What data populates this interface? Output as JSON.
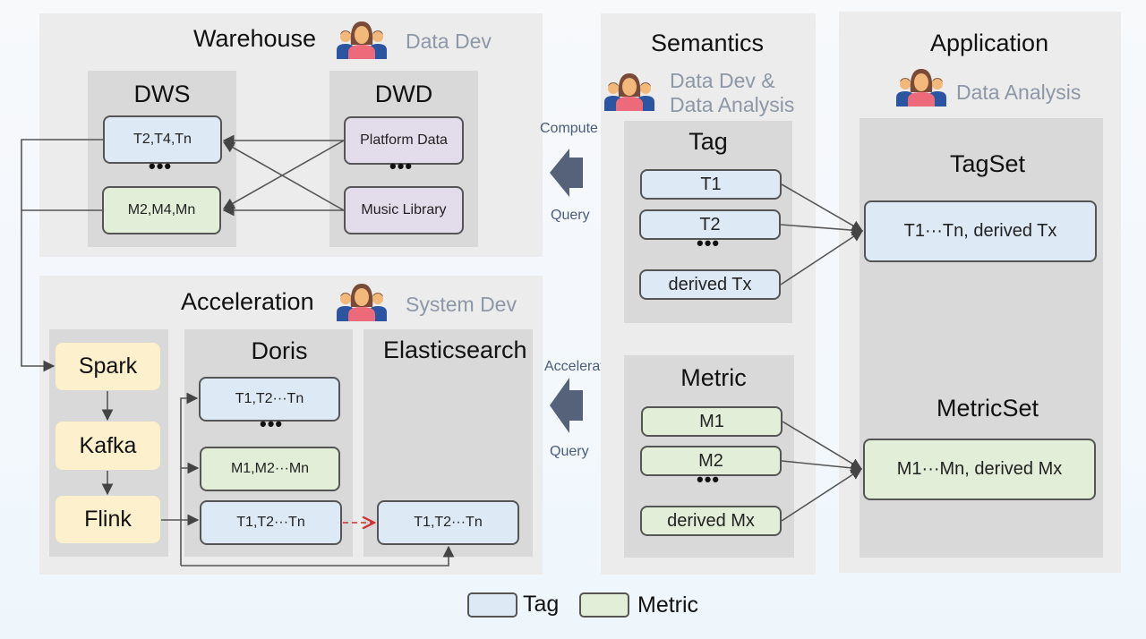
{
  "warehouse": {
    "title": "Warehouse",
    "role": "Data Dev",
    "dws": {
      "title": "DWS",
      "items": [
        {
          "label": "T2,T4,Tn",
          "kind": "tag"
        },
        {
          "label": "M2,M4,Mn",
          "kind": "metric"
        }
      ]
    },
    "dwd": {
      "title": "DWD",
      "items": [
        {
          "label": "Platform Data",
          "kind": "source"
        },
        {
          "label": "Music Library",
          "kind": "source"
        }
      ]
    },
    "ellipsis": "•••"
  },
  "acceleration": {
    "title": "Acceleration",
    "role": "System Dev",
    "pipeline": [
      "Spark",
      "Kafka",
      "Flink"
    ],
    "doris": {
      "title": "Doris",
      "items": [
        {
          "label": "T1,T2···Tn",
          "kind": "tag"
        },
        {
          "label": "M1,M2···Mn",
          "kind": "metric"
        },
        {
          "label": "T1,T2···Tn",
          "kind": "tag"
        }
      ]
    },
    "elasticsearch": {
      "title": "Elasticsearch",
      "items": [
        {
          "label": "T1,T2···Tn",
          "kind": "tag"
        }
      ]
    },
    "ellipsis": "•••"
  },
  "flows": {
    "top": {
      "above": "Compute",
      "below": "Query"
    },
    "bottom": {
      "above": "Accelerate",
      "below": "Query"
    }
  },
  "semantics": {
    "title": "Semantics",
    "role_line1": "Data Dev &",
    "role_line2": "Data Analysis",
    "tag": {
      "title": "Tag",
      "items": [
        "T1",
        "T2",
        "derived Tx"
      ]
    },
    "metric": {
      "title": "Metric",
      "items": [
        "M1",
        "M2",
        "derived Mx"
      ]
    },
    "ellipsis": "•••"
  },
  "application": {
    "title": "Application",
    "role": "Data Analysis",
    "tagset": {
      "title": "TagSet",
      "label": "T1···Tn, derived Tx"
    },
    "metricset": {
      "title": "MetricSet",
      "label": "M1···Mn, derived Mx"
    }
  },
  "legend": [
    {
      "label": "Tag",
      "color": "#dde9f5"
    },
    {
      "label": "Metric",
      "color": "#e2eed8"
    }
  ],
  "colors": {
    "tag": "#dde9f5",
    "metric": "#e2eed8",
    "source": "#e3dcea",
    "engine": "#fdf0cc",
    "arrow_block": "#55627a",
    "dashed_link": "#d03030"
  }
}
